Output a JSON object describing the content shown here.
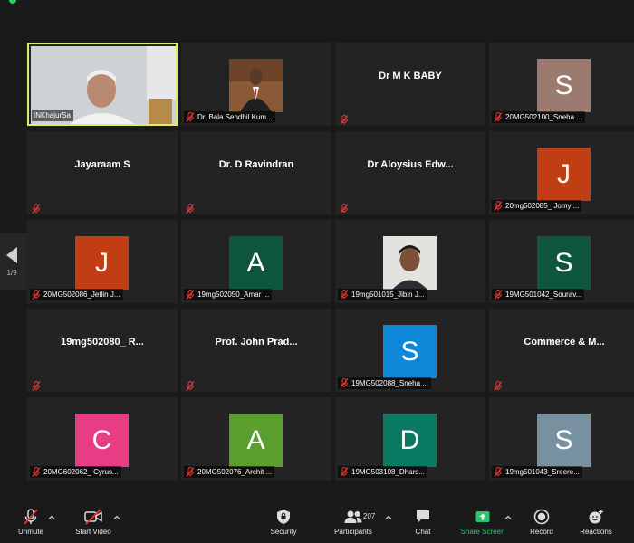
{
  "pager": {
    "label": "1/9"
  },
  "tiles": [
    {
      "name": "INKhajurSa",
      "kind": "video"
    },
    {
      "name": "Dr. Bala Sendhil Kum...",
      "kind": "photo"
    },
    {
      "name": "Dr M K BABY",
      "kind": "text"
    },
    {
      "name": "20MG502100_Sneha ...",
      "kind": "avatar",
      "initial": "S",
      "color": "#9c7a70"
    },
    {
      "name": "Jayaraam S",
      "kind": "text"
    },
    {
      "name": "Dr. D Ravindran",
      "kind": "text"
    },
    {
      "name": "Dr Aloysius Edw...",
      "kind": "text"
    },
    {
      "name": "20mg502085_ Jomy ...",
      "kind": "avatar",
      "initial": "J",
      "color": "#c13d14"
    },
    {
      "name": "20MG502086_Jetlin J...",
      "kind": "avatar",
      "initial": "J",
      "color": "#c13d14"
    },
    {
      "name": "19mg502050_Amar ...",
      "kind": "avatar",
      "initial": "A",
      "color": "#0e5640"
    },
    {
      "name": "19mg501015_Jibin J...",
      "kind": "photo"
    },
    {
      "name": "19MG501042_Sourav...",
      "kind": "avatar",
      "initial": "S",
      "color": "#0e5640"
    },
    {
      "name": "19mg502080_ R...",
      "kind": "text"
    },
    {
      "name": "Prof. John Prad...",
      "kind": "text"
    },
    {
      "name": "19MG502088_Sneha ...",
      "kind": "avatar",
      "initial": "S",
      "color": "#0e87d8"
    },
    {
      "name": "Commerce & M...",
      "kind": "text"
    },
    {
      "name": "20MG602062_ Cyrus...",
      "kind": "avatar",
      "initial": "C",
      "color": "#e83d84"
    },
    {
      "name": "20MG502076_Archit ...",
      "kind": "avatar",
      "initial": "A",
      "color": "#5b9e2e"
    },
    {
      "name": "19MG503108_Dhars...",
      "kind": "avatar",
      "initial": "D",
      "color": "#0a7a62"
    },
    {
      "name": "19mg501043_Sreere...",
      "kind": "avatar",
      "initial": "S",
      "color": "#7891a0"
    }
  ],
  "toolbar": {
    "unmute": "Unmute",
    "start_video": "Start Video",
    "security": "Security",
    "participants": "Participants",
    "participants_count": "207",
    "chat": "Chat",
    "share_screen": "Share Screen",
    "record": "Record",
    "reactions": "Reactions"
  },
  "colors": {
    "share_accent": "#28c76f",
    "active_speaker": "#d6f06a",
    "tile_bg": "#232323"
  }
}
